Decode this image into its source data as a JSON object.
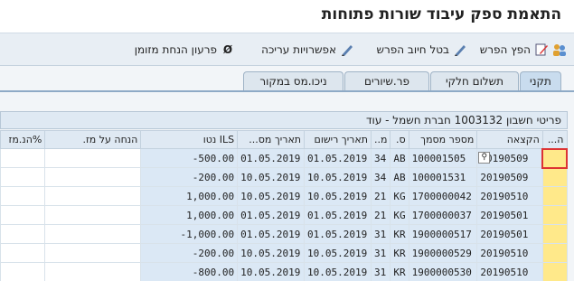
{
  "title": "התאמת ספק עיבוד שורות פתוחות",
  "toolbar": {
    "items": [
      {
        "label": "הפץ הפרש",
        "icon": "pencil-people-icon"
      },
      {
        "label": "בטל חיוב הפרש",
        "icon": "pencil-icon"
      },
      {
        "label": "אפשרויות עריכה",
        "icon": "edit-pencil-icon"
      },
      {
        "label": "פרעון הנחת מזומן",
        "icon": "no-entry-icon"
      }
    ]
  },
  "tabs": [
    "תקני",
    "תשלום חלקי",
    "פר.שיורים",
    "ניכו.מס במקור"
  ],
  "section_header": "פריטי חשבון 1003132 חברת חשמל - עוד",
  "columns": [
    "ה...",
    "הקצאה",
    "מספר מסמך",
    "ס.",
    "מ..",
    "תאריך רישום",
    "תאריך מס...",
    "ILS נטו",
    "הנחה על מז.",
    "%הנ.מז"
  ],
  "rows": [
    {
      "assign": "20190509",
      "doc": "100001505",
      "s": "AB",
      "m": "34",
      "post": "01.05.2019",
      "docdate": "01.05.2019",
      "net": "-500.00"
    },
    {
      "assign": "20190509",
      "doc": "100001531",
      "s": "AB",
      "m": "34",
      "post": "10.05.2019",
      "docdate": "10.05.2019",
      "net": "-200.00"
    },
    {
      "assign": "20190510",
      "doc": "1700000042",
      "s": "KG",
      "m": "21",
      "post": "10.05.2019",
      "docdate": "10.05.2019",
      "net": "1,000.00"
    },
    {
      "assign": "20190501",
      "doc": "1700000037",
      "s": "KG",
      "m": "21",
      "post": "01.05.2019",
      "docdate": "01.05.2019",
      "net": "1,000.00"
    },
    {
      "assign": "20190501",
      "doc": "1900000517",
      "s": "KR",
      "m": "31",
      "post": "01.05.2019",
      "docdate": "01.05.2019",
      "net": "-1,000.00"
    },
    {
      "assign": "20190510",
      "doc": "1900000529",
      "s": "KR",
      "m": "31",
      "post": "10.05.2019",
      "docdate": "10.05.2019",
      "net": "-200.00"
    },
    {
      "assign": "20190510",
      "doc": "1900000530",
      "s": "KR",
      "m": "31",
      "post": "10.05.2019",
      "docdate": "10.05.2019",
      "net": "-800.00"
    }
  ]
}
